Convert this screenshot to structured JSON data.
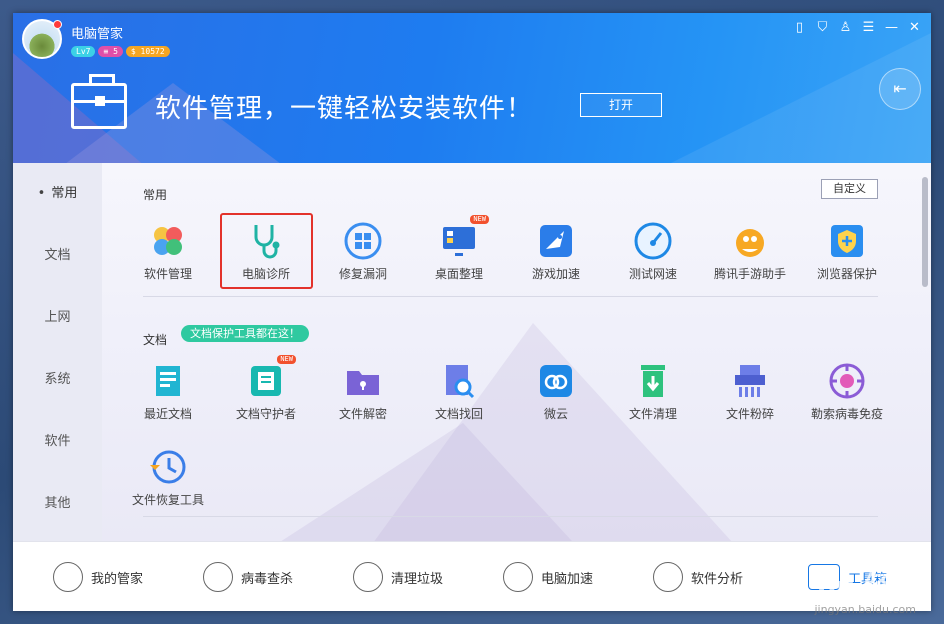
{
  "app": {
    "title": "电脑管家",
    "level": "Lv7",
    "vip": "5",
    "coins": "$ 10572"
  },
  "banner": {
    "headline": "软件管理，一键轻松安装软件！",
    "open_label": "打开"
  },
  "sidebar": {
    "items": [
      {
        "label": "常用",
        "active": true
      },
      {
        "label": "文档"
      },
      {
        "label": "上网"
      },
      {
        "label": "系统"
      },
      {
        "label": "软件"
      },
      {
        "label": "其他"
      }
    ]
  },
  "sections": {
    "common": {
      "title": "常用",
      "custom_label": "自定义",
      "tools": [
        {
          "label": "软件管理",
          "icon": "clover-icon"
        },
        {
          "label": "电脑诊所",
          "icon": "stethoscope-icon"
        },
        {
          "label": "修复漏洞",
          "icon": "windows-repair-icon"
        },
        {
          "label": "桌面整理",
          "icon": "monitor-icon",
          "new": "NEW"
        },
        {
          "label": "游戏加速",
          "icon": "rocket-game-icon"
        },
        {
          "label": "测试网速",
          "icon": "speedometer-icon"
        },
        {
          "label": "腾讯手游助手",
          "icon": "penguin-icon"
        },
        {
          "label": "浏览器保护",
          "icon": "shield-icon"
        }
      ]
    },
    "docs": {
      "title": "文档",
      "tag": "文档保护工具都在这！",
      "tools": [
        {
          "label": "最近文档",
          "icon": "recent-doc-icon"
        },
        {
          "label": "文档守护者",
          "icon": "doc-guard-icon",
          "new": "NEW"
        },
        {
          "label": "文件解密",
          "icon": "folder-lock-icon"
        },
        {
          "label": "文档找回",
          "icon": "doc-search-icon"
        },
        {
          "label": "微云",
          "icon": "cloud-icon"
        },
        {
          "label": "文件清理",
          "icon": "trash-icon"
        },
        {
          "label": "文件粉碎",
          "icon": "shredder-icon"
        },
        {
          "label": "勒索病毒免疫",
          "icon": "virus-icon"
        },
        {
          "label": "文件恢复工具",
          "icon": "restore-icon"
        }
      ]
    }
  },
  "bottom_nav": [
    {
      "label": "我的管家",
      "icon": "person-icon"
    },
    {
      "label": "病毒查杀",
      "icon": "virus-scan-icon"
    },
    {
      "label": "清理垃圾",
      "icon": "vacuum-icon"
    },
    {
      "label": "电脑加速",
      "icon": "rocket-icon"
    },
    {
      "label": "软件分析",
      "icon": "analysis-icon"
    },
    {
      "label": "工具箱",
      "icon": "toolbox-icon",
      "active": true
    }
  ],
  "watermark": {
    "text": "Bai du 经验",
    "url": "jingyan.baidu.com"
  },
  "colors": {
    "banner": "#1e7cf0",
    "accent_red": "#e3322b",
    "tag_green": "#2fc9a0",
    "active_blue": "#1677e5"
  }
}
